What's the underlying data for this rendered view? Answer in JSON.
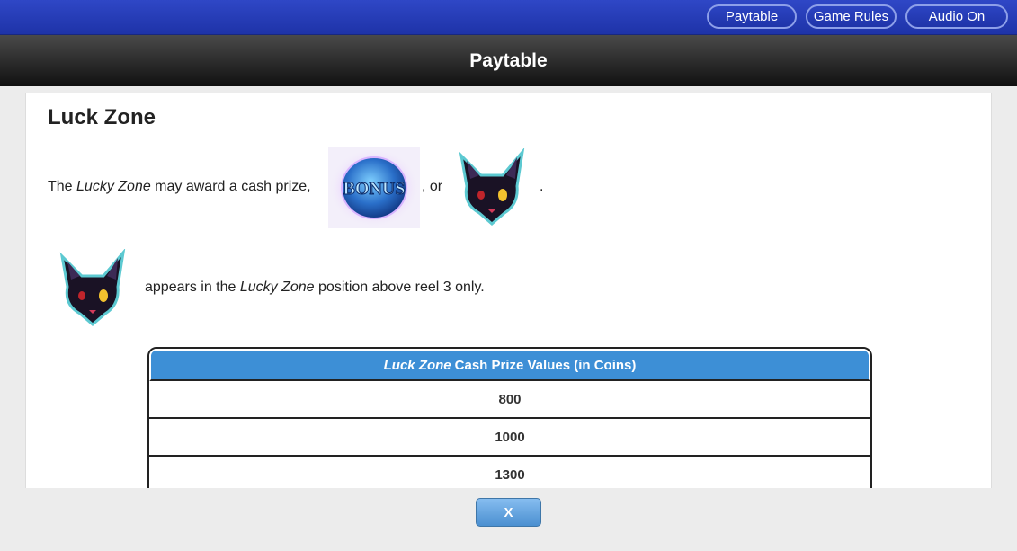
{
  "topnav": {
    "paytable_label": "Paytable",
    "game_rules_label": "Game Rules",
    "audio_label": "Audio On"
  },
  "header": {
    "title": "Paytable"
  },
  "section": {
    "title": "Luck Zone",
    "line1_pre": "The ",
    "line1_em": "Lucky Zone",
    "line1_post": " may award a cash prize,",
    "line1_sep": ", or",
    "line1_end": ".",
    "line2_pre": "appears in the ",
    "line2_em": "Lucky Zone",
    "line2_post": " position above reel 3 only.",
    "bonus_symbol_text": "BONUS"
  },
  "prize_table": {
    "header_em": "Luck Zone",
    "header_rest": "Cash Prize Values (in Coins)",
    "rows": [
      "800",
      "1000",
      "1300"
    ]
  },
  "footer": {
    "close_label": "X"
  },
  "colors": {
    "topbar": "#2238b4",
    "table_header": "#3d8fd6",
    "close_button": "#5fa2df"
  },
  "icons": {
    "bonus": "bonus-orb-icon",
    "cat": "black-cat-icon"
  }
}
